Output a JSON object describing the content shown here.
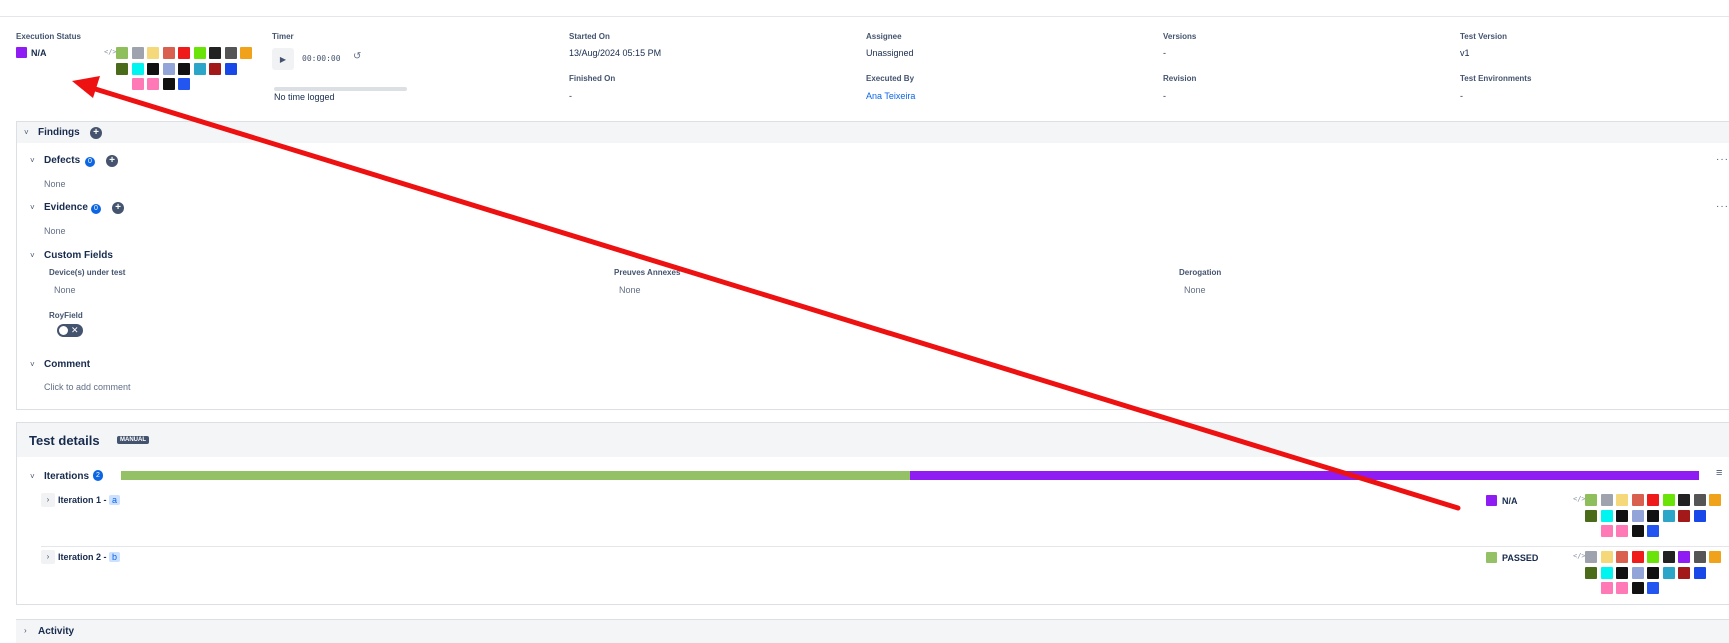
{
  "header": {
    "execution_status": {
      "label": "Execution Status",
      "value": "N/A",
      "color": "#8f1cf2"
    },
    "timer": {
      "label": "Timer",
      "value": "00:00:00",
      "no_time": "No time logged"
    },
    "started_on": {
      "label": "Started On",
      "value": "13/Aug/2024 05:15 PM"
    },
    "finished_on": {
      "label": "Finished On",
      "value": "-"
    },
    "assignee": {
      "label": "Assignee",
      "value": "Unassigned"
    },
    "executed_by": {
      "label": "Executed By",
      "value": "Ana Teixeira"
    },
    "versions": {
      "label": "Versions",
      "value": "-"
    },
    "revision": {
      "label": "Revision",
      "value": "-"
    },
    "test_version": {
      "label": "Test Version",
      "value": "v1"
    },
    "test_environments": {
      "label": "Test Environments",
      "value": "-"
    }
  },
  "palette": {
    "top": [
      "#8fbf5d",
      "#9ea3ad",
      "#f5d879",
      "#d9604f",
      "#ef1a1a",
      "#6ae308",
      "#222222",
      "#555555",
      "#f0a31a",
      "#4a6b1a",
      "#00f4f0",
      "#111111",
      "#93a5d8",
      "#111111",
      "#2ba6c9",
      "#a31919",
      "#1848e8",
      "#ff79b6",
      "#ff79b6",
      "#111111",
      "#2355f0"
    ],
    "iter1": [
      "#8fbf5d",
      "#9ea3ad",
      "#f5d879",
      "#d9604f",
      "#ef1a1a",
      "#6ae308",
      "#222222",
      "#555555",
      "#f0a31a",
      "#4a6b1a",
      "#00f4f0",
      "#111111",
      "#93a5d8",
      "#111111",
      "#2ba6c9",
      "#a31919",
      "#1848e8",
      "#ff79b6",
      "#ff79b6",
      "#111111",
      "#2355f0"
    ],
    "iter2": [
      "#9ea3ad",
      "#f5d879",
      "#d9604f",
      "#ef1a1a",
      "#6ae308",
      "#222222",
      "#8f1cf2",
      "#555555",
      "#f0a31a",
      "#4a6b1a",
      "#00f4f0",
      "#111111",
      "#93a5d8",
      "#111111",
      "#2ba6c9",
      "#a31919",
      "#1848e8",
      "#ff79b6",
      "#ff79b6",
      "#111111",
      "#2355f0"
    ]
  },
  "findings": {
    "title": "Findings",
    "defects": {
      "title": "Defects",
      "count": "0",
      "empty": "None"
    },
    "evidence": {
      "title": "Evidence",
      "count": "0",
      "empty": "None"
    }
  },
  "custom_fields": {
    "title": "Custom Fields",
    "devices": {
      "label": "Device(s) under test",
      "value": "None"
    },
    "preuves": {
      "label": "Preuves Annexes",
      "value": "None"
    },
    "derogation": {
      "label": "Derogation",
      "value": "None"
    },
    "royfield": {
      "label": "RoyField"
    }
  },
  "comment": {
    "title": "Comment",
    "placeholder": "Click to add comment"
  },
  "test_details": {
    "title": "Test details",
    "badge": "MANUAL",
    "iterations_title": "Iterations",
    "iterations_count": "2",
    "progress": [
      {
        "status": "PASSED",
        "fraction": 0.5,
        "color": "#94c066"
      },
      {
        "status": "N/A",
        "fraction": 0.5,
        "color": "#8f1cf2"
      }
    ],
    "iterations": [
      {
        "label": "Iteration 1 -",
        "tag": "a",
        "status": "N/A",
        "status_color": "#8f1cf2"
      },
      {
        "label": "Iteration 2 -",
        "tag": "b",
        "status": "PASSED",
        "status_color": "#94c066"
      }
    ]
  },
  "activity": {
    "title": "Activity"
  },
  "annotation": {
    "color": "#ee1111"
  }
}
